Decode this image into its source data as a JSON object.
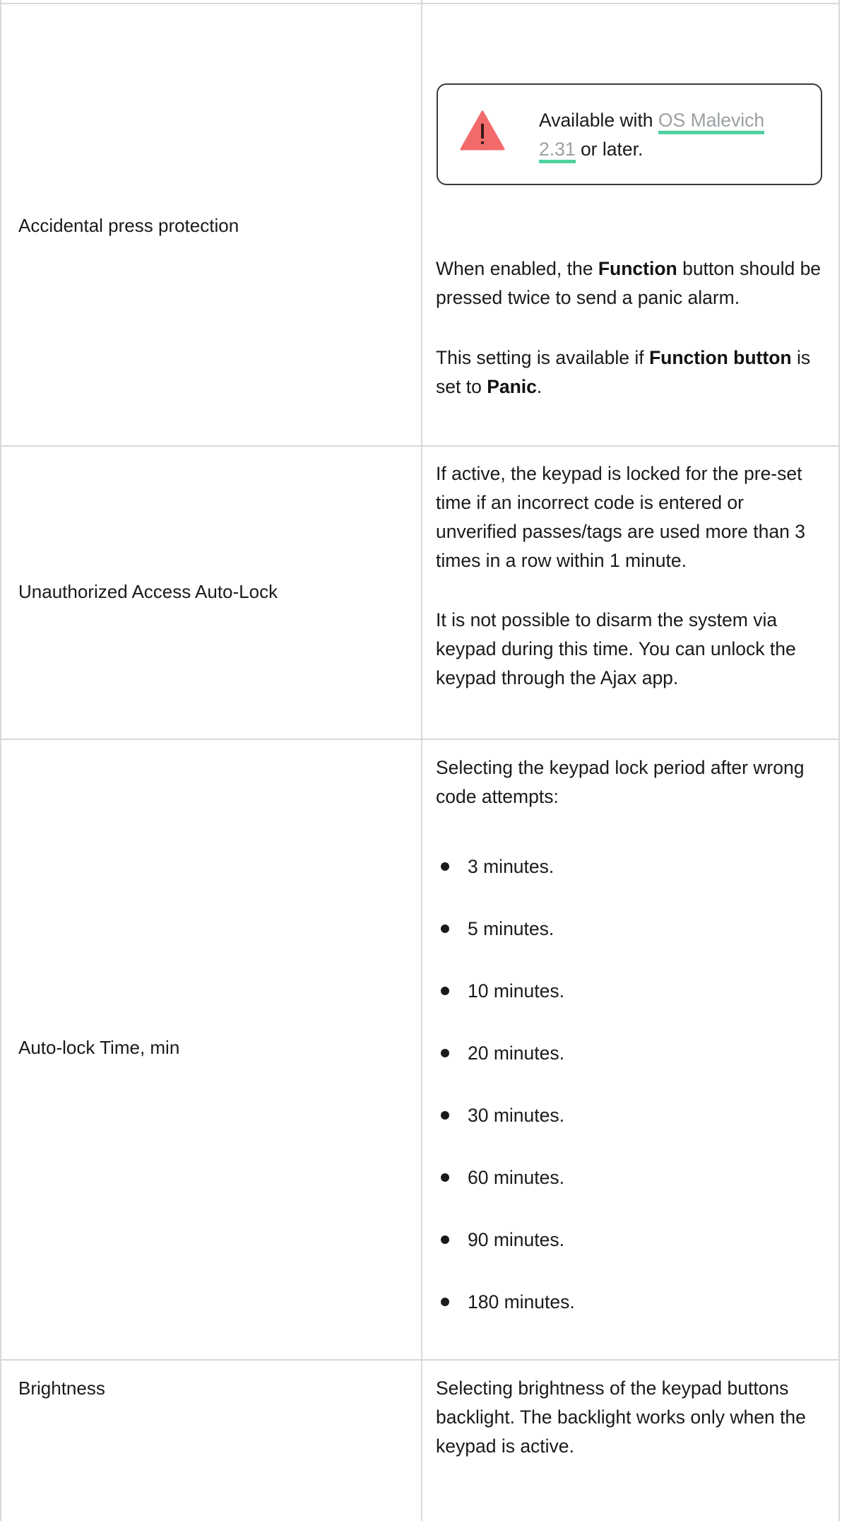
{
  "rows": [
    {
      "setting": "Accidental press protection",
      "notice": {
        "prefix": "Available with ",
        "link_line1": "OS Malevich",
        "link_line2": "2.31",
        "suffix": " or later.",
        "icon": "warning-triangle-icon",
        "icon_color": "#f26b6b",
        "link_underline_color": "#4fd1a0"
      },
      "p1": {
        "a": "When enabled, the ",
        "b": "Function",
        "c": " button should be pressed twice to send a panic alarm."
      },
      "p2": {
        "a": "This setting is available if ",
        "b": "Function button",
        "c": " is set to ",
        "d": "Panic",
        "e": "."
      }
    },
    {
      "setting": "Unauthorized Access Auto-Lock",
      "p1": "If active, the keypad is locked for the pre-set time if an incorrect code is entered or unverified passes/tags are used more than 3 times in a row within 1 minute.",
      "p2": "It is not possible to disarm the system via keypad during this time. You can unlock the keypad through the Ajax app."
    },
    {
      "setting": "Auto-lock Time, min",
      "intro": "Selecting the keypad lock period after wrong code attempts:",
      "options": [
        "3 minutes.",
        "5 minutes.",
        "10 minutes.",
        "20 minutes.",
        "30 minutes.",
        "60 minutes.",
        "90 minutes.",
        "180 minutes."
      ]
    },
    {
      "setting": "Brightness",
      "desc": "Selecting brightness of the keypad buttons backlight. The backlight works only when the keypad is active."
    }
  ]
}
